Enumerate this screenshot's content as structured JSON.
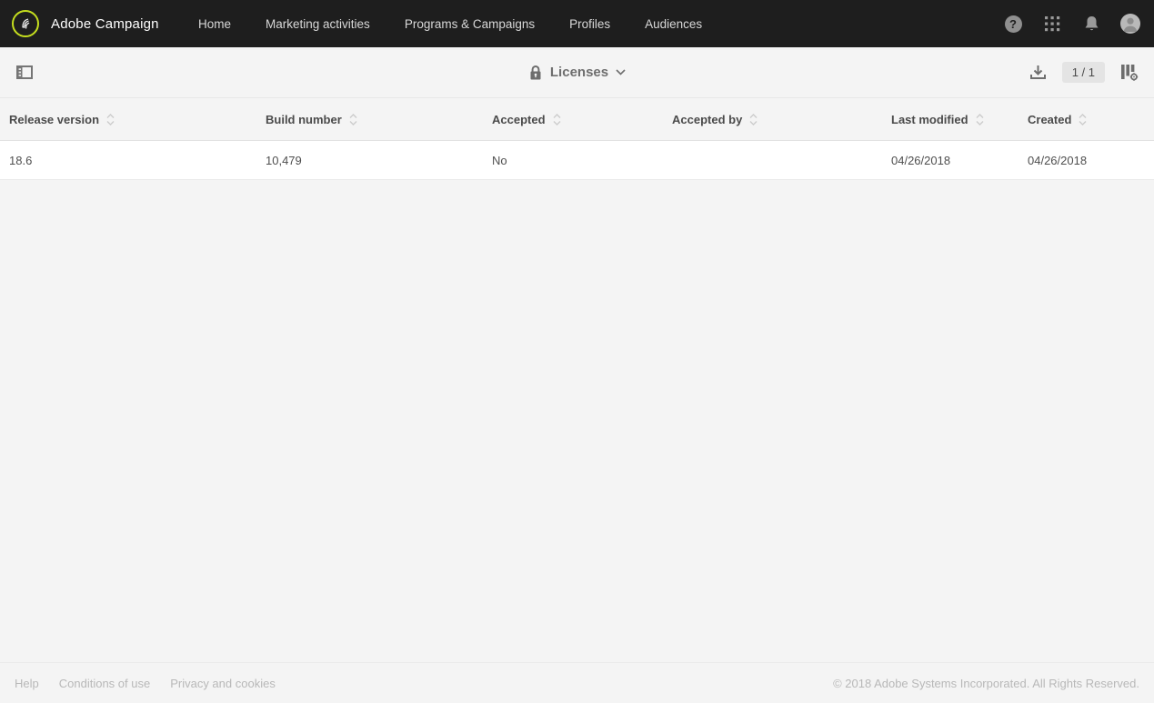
{
  "topnav": {
    "brand": "Adobe Campaign",
    "items": [
      {
        "label": "Home"
      },
      {
        "label": "Marketing activities"
      },
      {
        "label": "Programs & Campaigns"
      },
      {
        "label": "Profiles"
      },
      {
        "label": "Audiences"
      }
    ],
    "help_glyph": "?"
  },
  "toolbar": {
    "title": "Licenses",
    "page_indicator": "1 / 1"
  },
  "table": {
    "columns": [
      {
        "label": "Release version"
      },
      {
        "label": "Build number"
      },
      {
        "label": "Accepted"
      },
      {
        "label": "Accepted by"
      },
      {
        "label": "Last modified"
      },
      {
        "label": "Created"
      }
    ],
    "rows": [
      {
        "release_version": "18.6",
        "build_number": "10,479",
        "accepted": "No",
        "accepted_by": "",
        "last_modified": "04/26/2018",
        "created": "04/26/2018"
      }
    ]
  },
  "footer": {
    "links": [
      {
        "label": "Help"
      },
      {
        "label": "Conditions of use"
      },
      {
        "label": "Privacy and cookies"
      }
    ],
    "copyright": "© 2018 Adobe Systems Incorporated. All Rights Reserved."
  },
  "colors": {
    "topbar_bg": "#1e1e1e",
    "logo_ring": "#c6df1e",
    "page_bg": "#f4f4f4",
    "icon_gray": "#6e6e6e",
    "header_text": "#4a4a4a"
  }
}
